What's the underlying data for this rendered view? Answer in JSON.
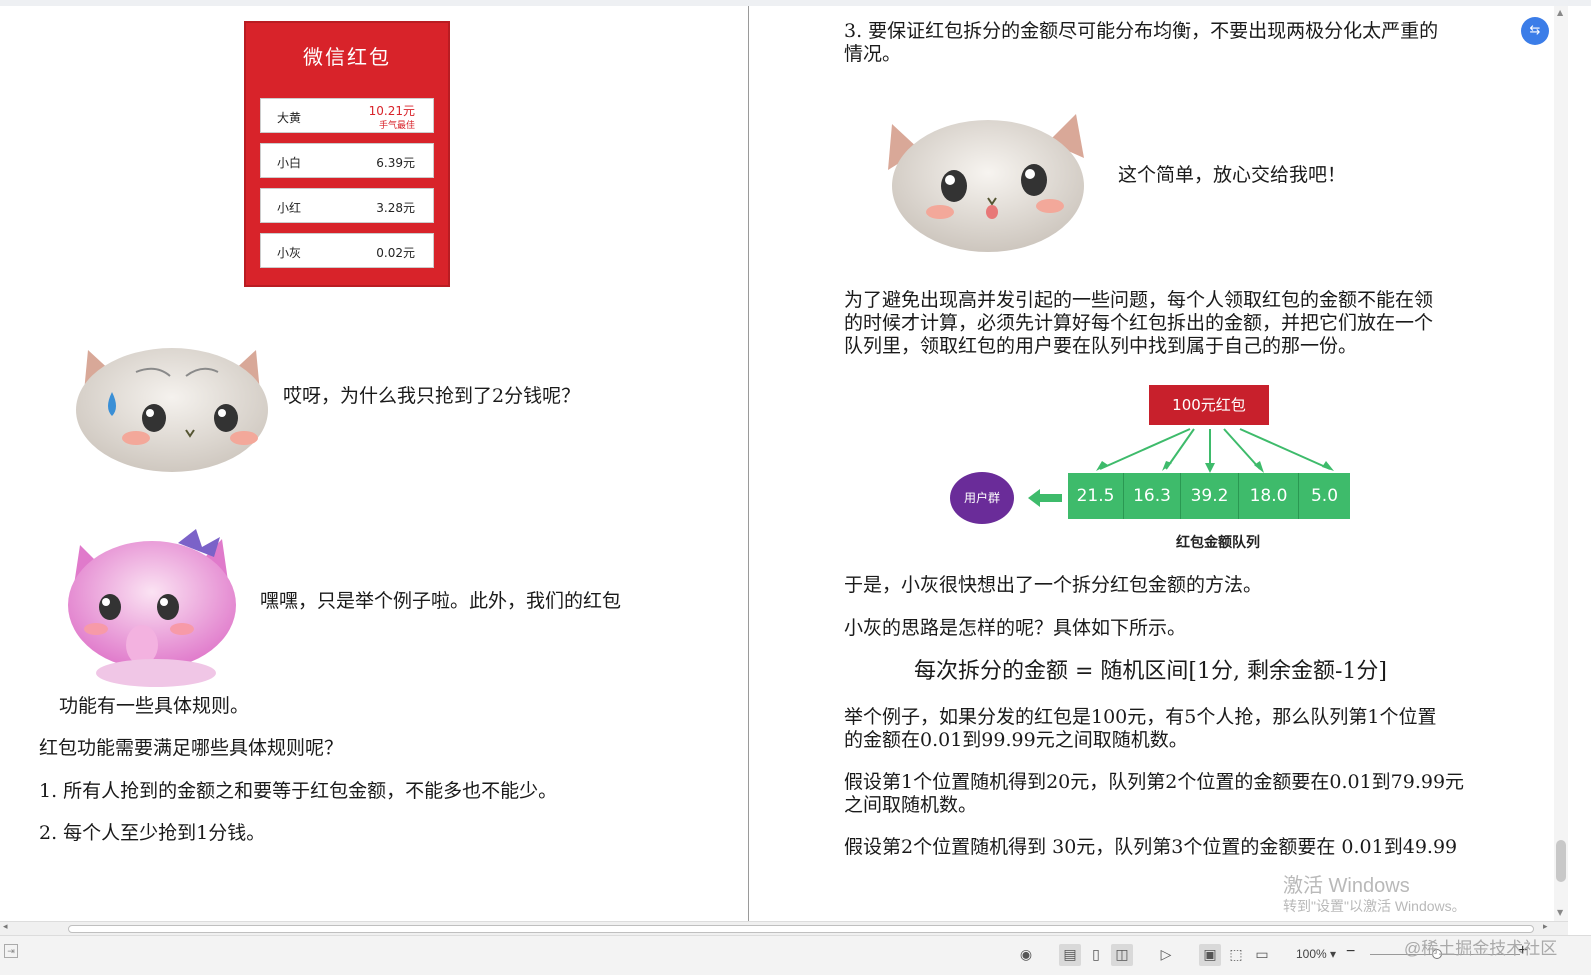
{
  "left_page": {
    "envelope": {
      "title": "微信红包",
      "rows": [
        {
          "name": "大黄",
          "amount": "10.21元",
          "note": "手气最佳"
        },
        {
          "name": "小白",
          "amount": "6.39元",
          "note": ""
        },
        {
          "name": "小红",
          "amount": "3.28元",
          "note": ""
        },
        {
          "name": "小灰",
          "amount": "0.02元",
          "note": ""
        }
      ]
    },
    "dialog_1": "哎呀，为什么我只抢到了2分钱呢？",
    "dialog_2": "嘿嘿，只是举个例子啦。此外，我们的红包",
    "dialog_2_cont": "功能有一些具体规则。",
    "question": "红包功能需要满足哪些具体规则呢？",
    "rule_1": "1. 所有人抢到的金额之和要等于红包金额，不能多也不能少。",
    "rule_2": "2. 每个人至少抢到1分钱。"
  },
  "right_page": {
    "rule_3_line1": "3. 要保证红包拆分的金额尽可能分布均衡，不要出现两极分化太严重的",
    "rule_3_line2": "情况。",
    "dialog_3": "这个简单，放心交给我吧！",
    "para1_line1": "为了避免出现高并发引起的一些问题，每个人领取红包的金额不能在领",
    "para1_line2": "的时候才计算，必须先计算好每个红包拆出的金额，并把它们放在一个",
    "para1_line3": "队列里，领取红包的用户要在队列中找到属于自己的那一份。",
    "diagram": {
      "envelope_label": "100元红包",
      "users_label": "用户群",
      "queue_values": [
        "21.5",
        "16.3",
        "39.2",
        "18.0",
        "5.0"
      ],
      "caption": "红包金额队列",
      "colors": {
        "envelope": "#c8202c",
        "queue": "#3ebb6b",
        "users": "#6a2c99"
      }
    },
    "para2": "于是，小灰很快想出了一个拆分红包金额的方法。",
    "para3": "小灰的思路是怎样的呢？具体如下所示。",
    "formula": "每次拆分的金额 = 随机区间[1分, 剩余金额-1分]",
    "para4_line1": "举个例子，如果分发的红包是100元，有5个人抢，那么队列第1个位置",
    "para4_line2": "的金额在0.01到99.99元之间取随机数。",
    "para5_line1": "假设第1个位置随机得到20元，队列第2个位置的金额要在0.01到79.99元",
    "para5_line2": "之间取随机数。",
    "para6": "假设第2个位置随机得到  30元，队列第3个位置的金额要在  0.01到49.99"
  },
  "watermarks": {
    "activate_title": "激活 Windows",
    "activate_sub": "转到\"设置\"以激活 Windows。",
    "site": "@稀土掘金技术社区"
  },
  "statusbar": {
    "zoom": "100%",
    "icons": [
      "eye-icon",
      "page-view-icon",
      "single-page-icon",
      "two-page-icon",
      "play-icon",
      "fit-page-icon",
      "fit-width-icon",
      "book-icon"
    ]
  }
}
